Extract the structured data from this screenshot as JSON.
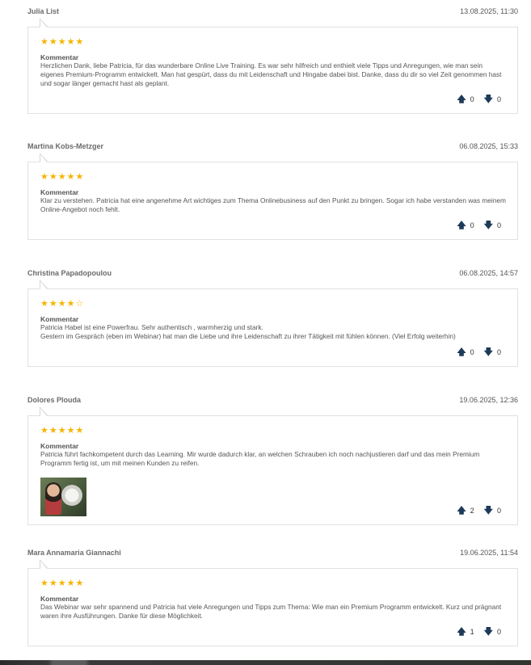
{
  "reviews": [
    {
      "author": "Julia List",
      "date": "13.08.2025, 11:30",
      "stars": "★★★★★",
      "label": "Kommentar",
      "text": "Herzlichen Dank, liebe Patricia, für das wunderbare Online Live Training. Es war sehr hilfreich und enthielt viele Tipps und Anregungen, wie man sein eigenes Premium-Programm entwickelt. Man hat gespürt, dass du mit Leidenschaft und Hingabe dabei bist. Danke, dass du dir so viel Zeit genommen hast und sogar länger gemacht hast als geplant.",
      "up": "0",
      "down": "0"
    },
    {
      "author": "Martina Kobs-Metzger",
      "date": "06.08.2025, 15:33",
      "stars": "★★★★★",
      "label": "Kommentar",
      "text": "Klar zu verstehen. Patricia hat eine angenehme Art wichtiges zum Thema Onlinebusiness auf den Punkt zu bringen. Sogar ich habe verstanden was meinem Online-Angebot noch fehlt.",
      "up": "0",
      "down": "0"
    },
    {
      "author": "Christina Papadopoulou",
      "date": "06.08.2025, 14:57",
      "stars": "★★★★☆",
      "label": "Kommentar",
      "text": "Patricia Habel ist eine Powerfrau. Sehr authentisch , warmherzig und stark.",
      "text2": "Gestern im Gespräch (eben im Webinar) hat man die Liebe und ihre Leidenschaft zu ihrer Tätigkeit mit fühlen können. (Viel Erfolg weiterhin)",
      "up": "0",
      "down": "0"
    },
    {
      "author": "Dolores Plouda",
      "date": "19.06.2025, 12:36",
      "stars": "★★★★★",
      "label": "Kommentar",
      "text": "Patricia führt fachkompetent durch das Learning. Mir wurde dadurch klar, an welchen Schrauben ich noch nachjustieren darf und das mein Premium Programm fertig ist, um mit meinen Kunden zu reifen.",
      "up": "2",
      "down": "0"
    },
    {
      "author": "Mara Annamaria Giannachi",
      "date": "19.06.2025, 11:54",
      "stars": "★★★★★",
      "label": "Kommentar",
      "text": "Das Webinar war sehr spannend und Patricia hat viele Anregungen und Tipps zum Thema: Wie man ein Premium Programm entwickelt. Kurz und prägnant waren ihre Ausführungen. Danke für diese Möglichkeit.",
      "up": "1",
      "down": "0"
    }
  ],
  "icons": {
    "upvote": "arrow-up-icon",
    "downvote": "arrow-down-icon",
    "star": "star-icon"
  },
  "colors": {
    "star": "#f5b400",
    "arrow": "#1d3a59",
    "border": "#e1e1e1"
  }
}
